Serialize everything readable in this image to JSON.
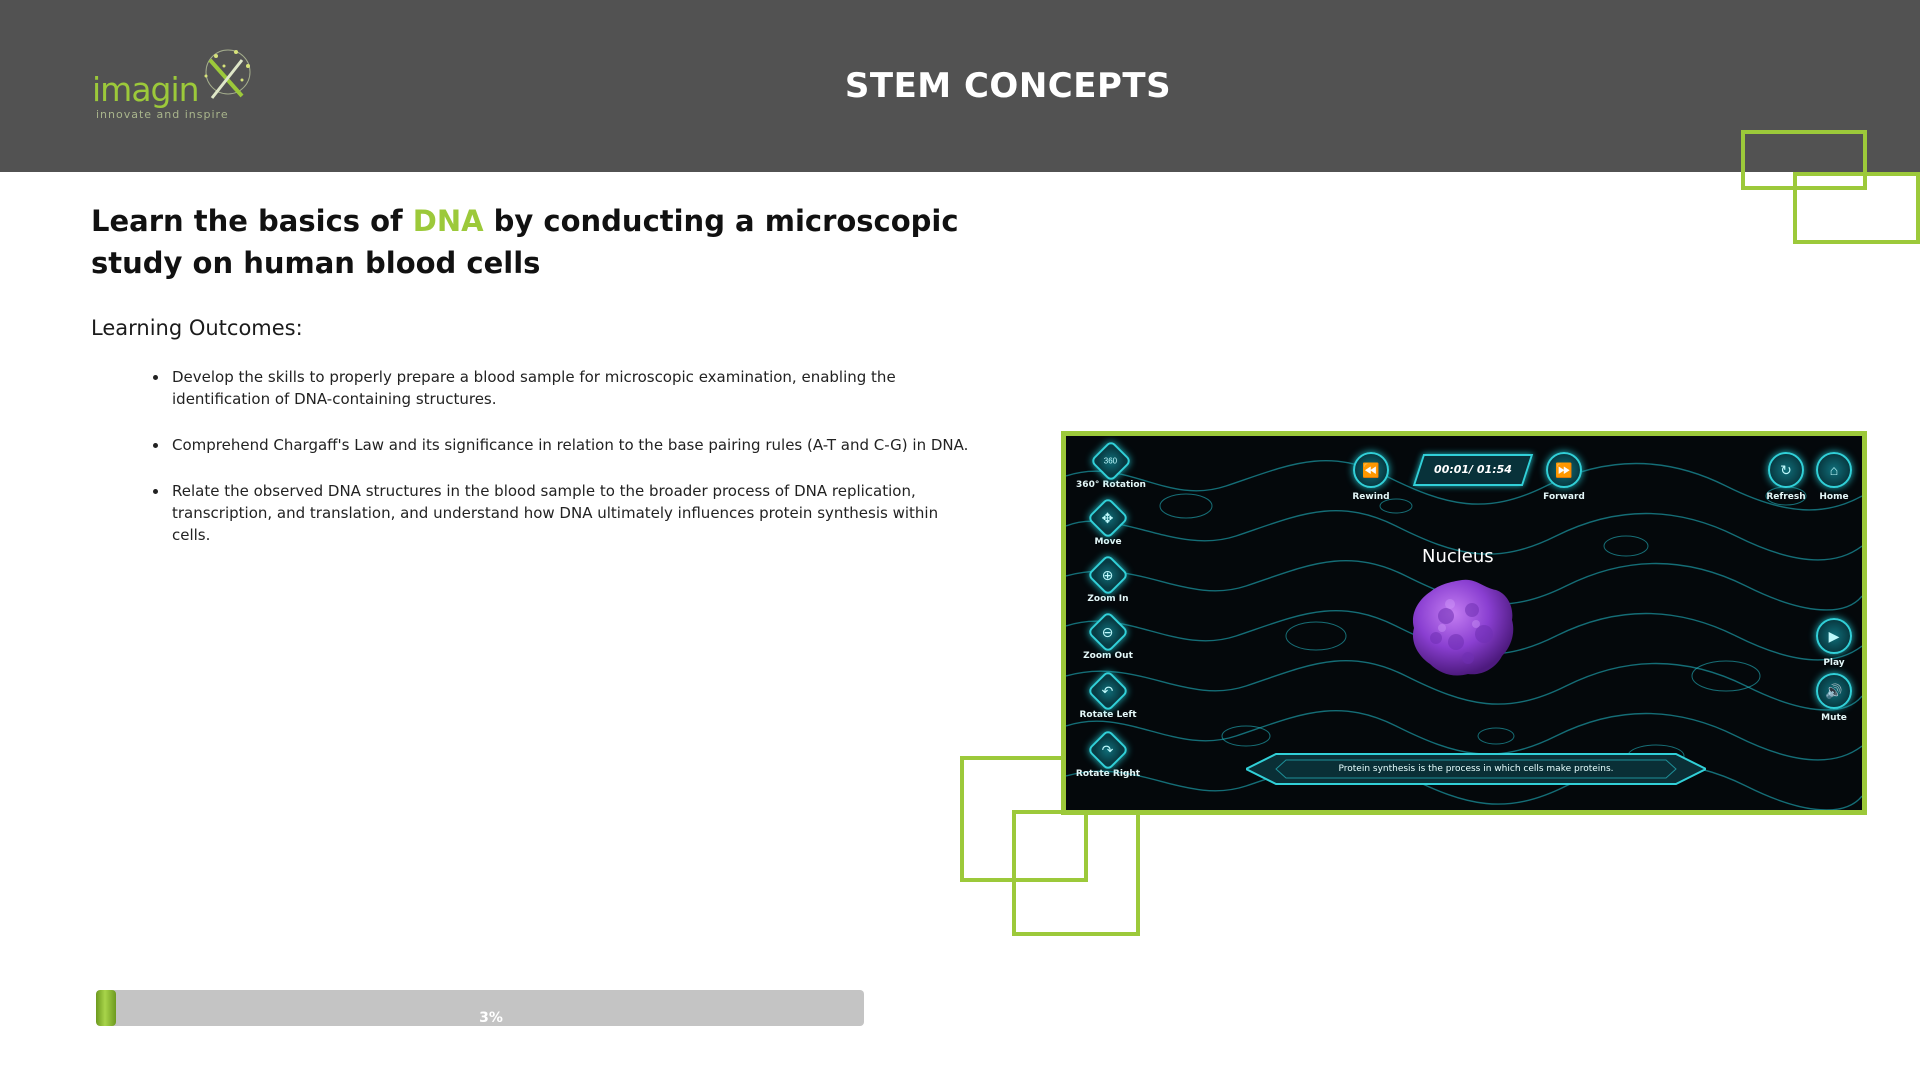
{
  "brand": {
    "logo_text": "imagin",
    "logo_tagline": "innovate and inspire",
    "accent_color": "#9cc93a",
    "header_bg": "#525252"
  },
  "header": {
    "title": "STEM CONCEPTS"
  },
  "lesson": {
    "headline_pre": "Learn the basics of ",
    "headline_accent": "DNA",
    "headline_post": " by conducting a microscopic study on human blood cells",
    "outcomes_heading": "Learning Outcomes:",
    "outcomes": [
      "Develop the skills to properly prepare a blood sample for microscopic examination, enabling the identification of DNA-containing structures.",
      "Comprehend Chargaff's Law and its significance in relation to the base pairing rules (A-T and C-G) in DNA.",
      "Relate the observed DNA structures in the blood sample to the broader process of DNA replication, transcription, and translation, and understand how DNA ultimately influences protein synthesis within cells."
    ]
  },
  "media": {
    "left_controls": [
      {
        "label": "360° Rotation",
        "icon": "rotation-360-icon",
        "glyph": "360"
      },
      {
        "label": "Move",
        "icon": "move-icon",
        "glyph": "✥"
      },
      {
        "label": "Zoom In",
        "icon": "zoom-in-icon",
        "glyph": "⊕"
      },
      {
        "label": "Zoom Out",
        "icon": "zoom-out-icon",
        "glyph": "⊖"
      },
      {
        "label": "Rotate Left",
        "icon": "rotate-left-icon",
        "glyph": "↶"
      },
      {
        "label": "Rotate Right",
        "icon": "rotate-right-icon",
        "glyph": "↷"
      }
    ],
    "rewind_label": "Rewind",
    "forward_label": "Forward",
    "refresh_label": "Refresh",
    "home_label": "Home",
    "play_label": "Play",
    "mute_label": "Mute",
    "timer": "00:01/ 01:54",
    "object_label": "Nucleus",
    "caption": "Protein synthesis is the process in which cells make proteins.",
    "ui_color": "#31d0d8",
    "nucleus_color": "#8a3fd1"
  },
  "progress": {
    "percent_value": 0.03,
    "label": "3%"
  }
}
